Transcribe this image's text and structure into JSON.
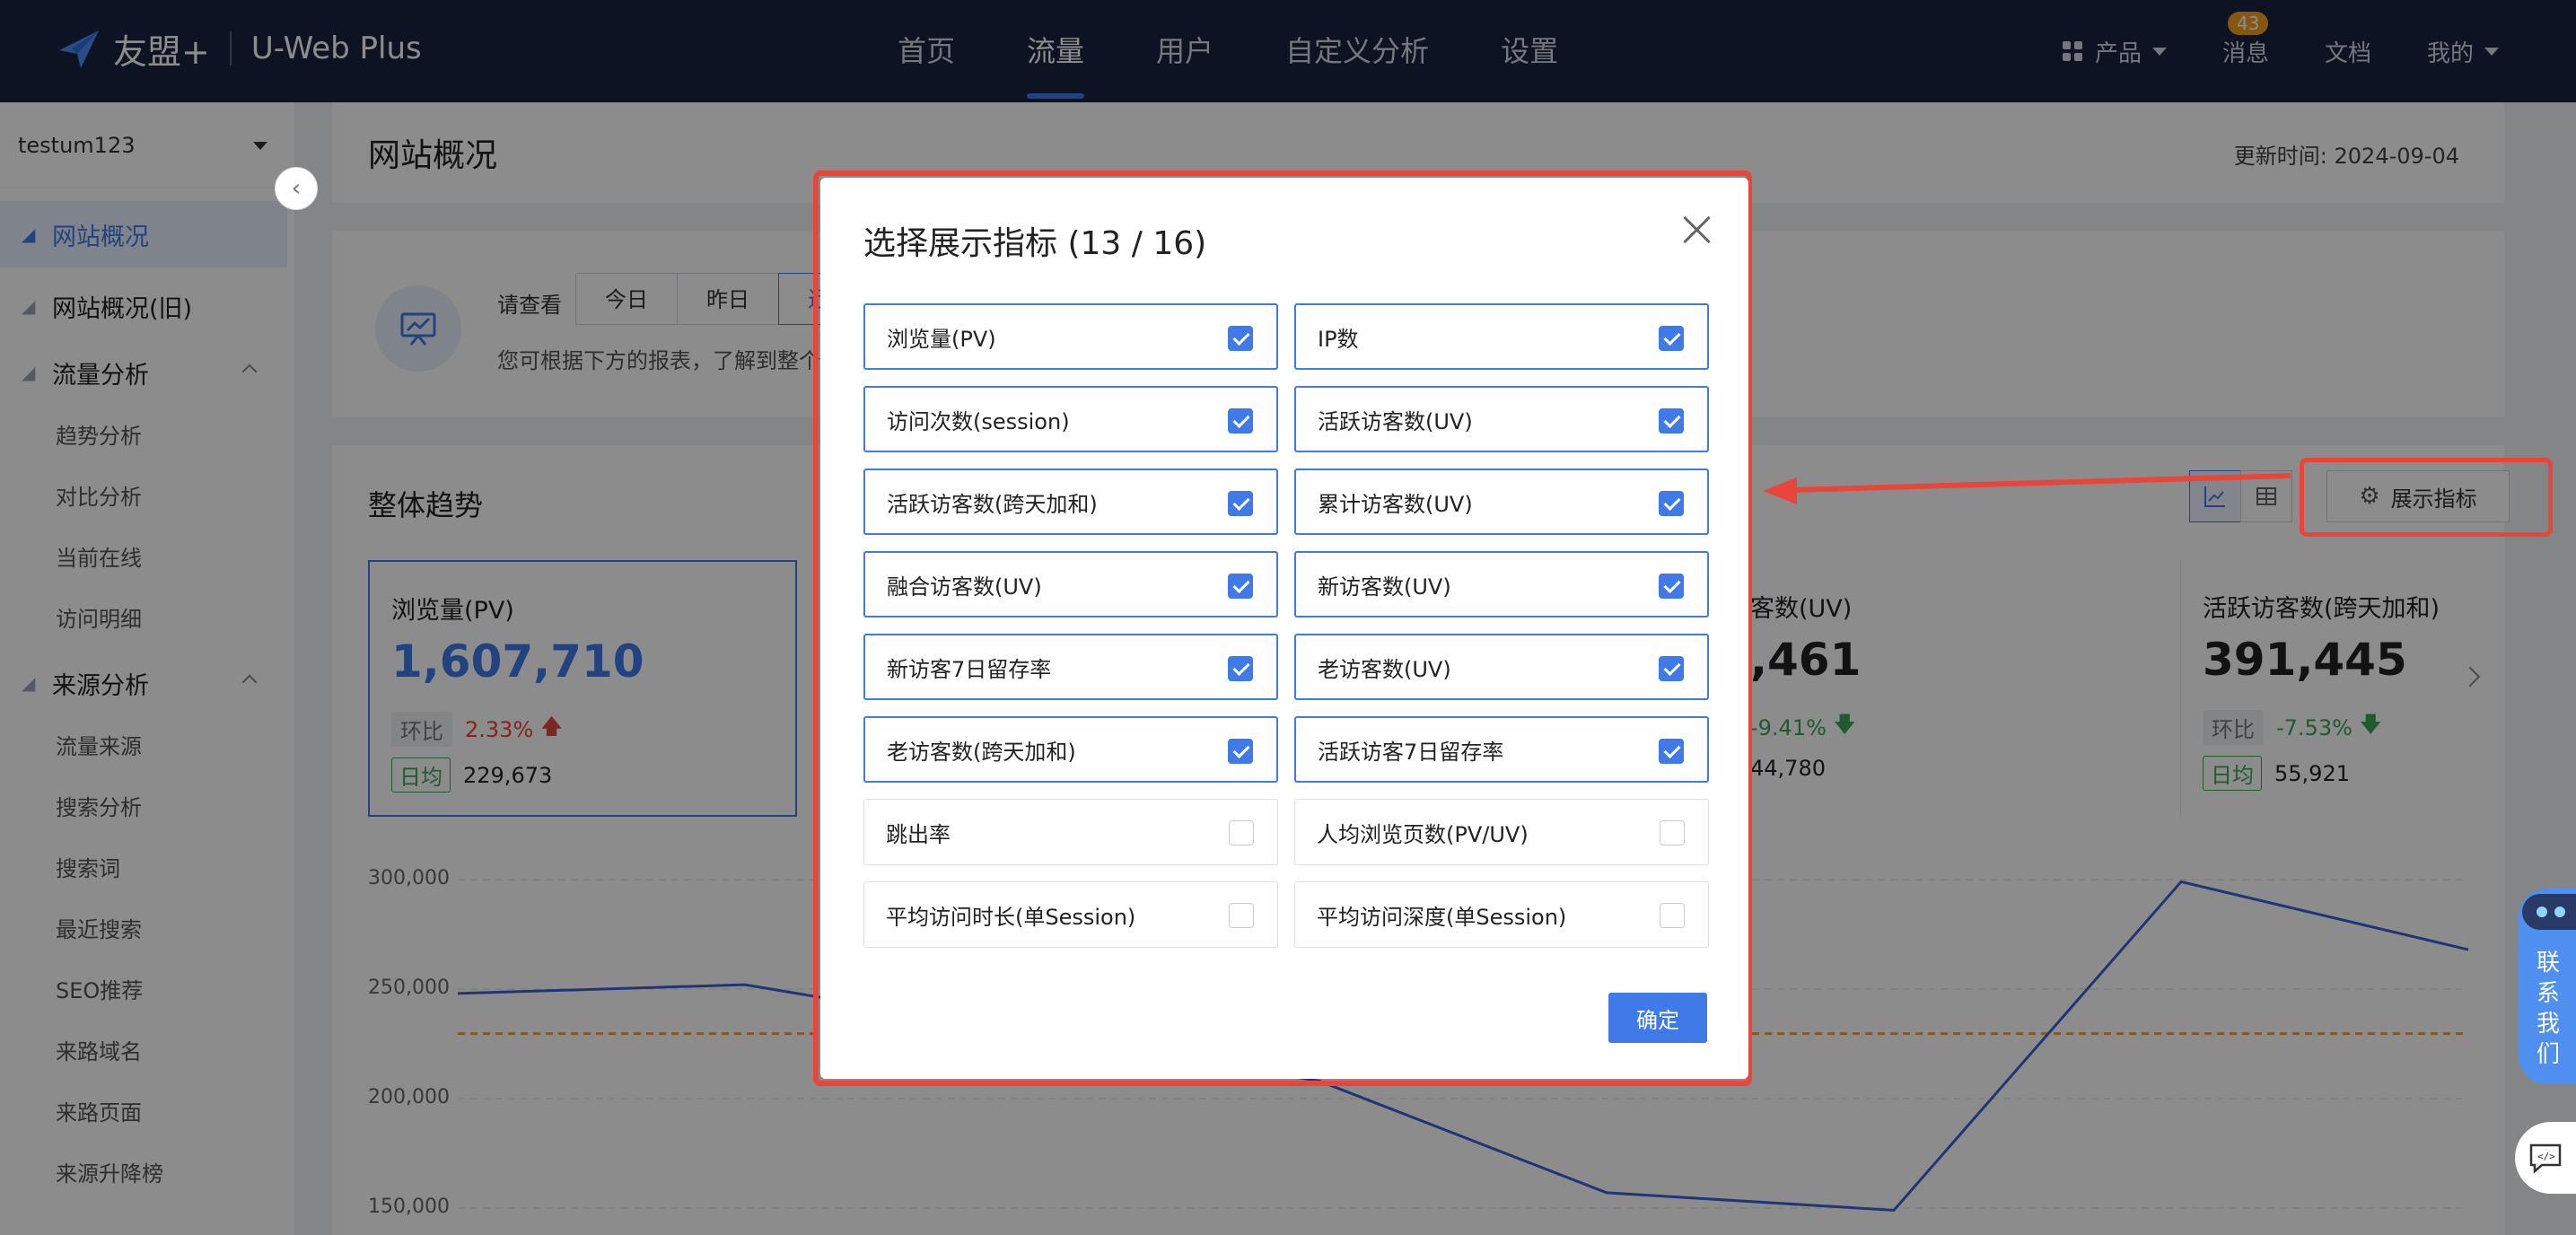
{
  "topbar": {
    "logo_text": "友盟+",
    "product_name": "U-Web Plus",
    "nav": [
      "首页",
      "流量",
      "用户",
      "自定义分析",
      "设置"
    ],
    "active_nav": "流量",
    "right": {
      "products": "产品",
      "messages": "消息",
      "messages_badge": "43",
      "docs": "文档",
      "mine": "我的"
    }
  },
  "sidebar": {
    "site": "testum123",
    "items": [
      {
        "label": "网站概况",
        "active": true
      },
      {
        "label": "网站概况(旧)"
      },
      {
        "label": "流量分析",
        "expanded": true,
        "children": [
          "趋势分析",
          "对比分析",
          "当前在线",
          "访问明细"
        ]
      },
      {
        "label": "来源分析",
        "expanded": true,
        "children": [
          "流量来源",
          "搜索分析",
          "搜索词",
          "最近搜索",
          "SEO推荐",
          "来路域名",
          "来路页面",
          "来源升降榜"
        ]
      }
    ]
  },
  "main": {
    "page_title": "网站概况",
    "update_time": "更新时间: 2024-09-04",
    "info": {
      "view_label": "请查看",
      "range_buttons": [
        "今日",
        "昨日",
        "近"
      ],
      "desc": "您可根据下方的报表，了解到整个"
    },
    "trend": {
      "title": "整体趋势",
      "metrics_button": "展示指标",
      "kpis": [
        {
          "name": "浏览量(PV)",
          "value": "1,607,710",
          "compare_label": "环比",
          "change": "2.33%",
          "direction": "up",
          "avg_label": "日均",
          "avg": "229,673"
        },
        {
          "name": "客数(UV)",
          "value": ",461",
          "change": "-9.41%",
          "direction": "down",
          "avg": "44,780"
        },
        {
          "name": "活跃访客数(跨天加和)",
          "value": "391,445",
          "compare_label": "环比",
          "change": "-7.53%",
          "direction": "down",
          "avg_label": "日均",
          "avg": "55,921"
        }
      ]
    }
  },
  "chart_data": {
    "type": "line",
    "y_ticks": [
      "300,000",
      "250,000",
      "200,000",
      "150,000"
    ],
    "ylim": [
      150000,
      300000
    ],
    "series": [
      {
        "values": [
          248000,
          252000,
          null,
          208000,
          157000,
          149000,
          299000,
          268000
        ],
        "color": "#3d5fd6"
      }
    ],
    "reference_line": {
      "value": 229673,
      "color": "#f0a040"
    }
  },
  "modal": {
    "title": "选择展示指标 (13 / 16)",
    "confirm": "确定",
    "options": [
      {
        "label": "浏览量(PV)",
        "checked": true
      },
      {
        "label": "IP数",
        "checked": true
      },
      {
        "label": "访问次数(session)",
        "checked": true
      },
      {
        "label": "活跃访客数(UV)",
        "checked": true
      },
      {
        "label": "活跃访客数(跨天加和)",
        "checked": true
      },
      {
        "label": "累计访客数(UV)",
        "checked": true
      },
      {
        "label": "融合访客数(UV)",
        "checked": true
      },
      {
        "label": "新访客数(UV)",
        "checked": true
      },
      {
        "label": "新访客7日留存率",
        "checked": true
      },
      {
        "label": "老访客数(UV)",
        "checked": true
      },
      {
        "label": "老访客数(跨天加和)",
        "checked": true
      },
      {
        "label": "活跃访客7日留存率",
        "checked": true
      },
      {
        "label": "跳出率",
        "checked": false
      },
      {
        "label": "人均浏览页数(PV/UV)",
        "checked": false
      },
      {
        "label": "平均访问时长(单Session)",
        "checked": false
      },
      {
        "label": "平均访问深度(单Session)",
        "checked": false
      }
    ]
  },
  "floating": {
    "contact": "联系我们"
  },
  "colors": {
    "accent": "#3f7ae8",
    "highlight": "#e8453b",
    "nav_bg": "#1a2340"
  }
}
